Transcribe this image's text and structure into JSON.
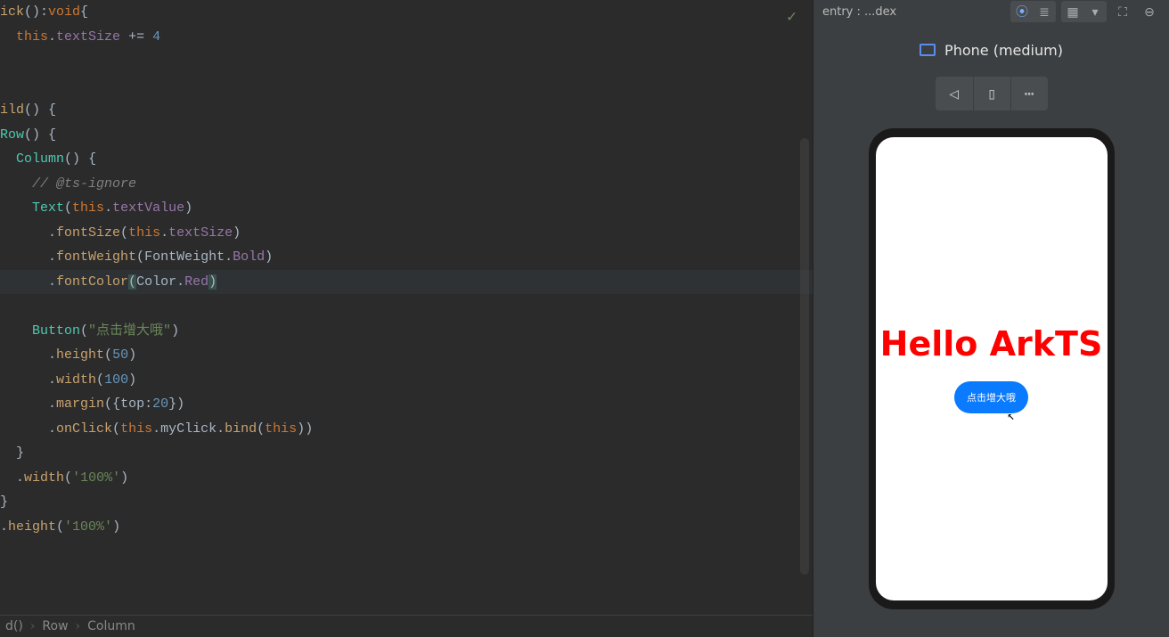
{
  "editor": {
    "checkmark": "✓",
    "lines": {
      "l0": {
        "p0": "ick",
        "paren1": "():",
        "kw": "void",
        "brace": "{"
      },
      "l1": {
        "indent": "  ",
        "kw": "this",
        "dot": ".",
        "prop": "textSize",
        "op": " += ",
        "num": "4"
      },
      "l2": "",
      "l3": "",
      "l4": {
        "fn": "ild",
        "paren": "()",
        "sp": " ",
        "brace": "{"
      },
      "l5": {
        "fn": "Row",
        "paren": "()",
        "sp": " ",
        "brace": "{"
      },
      "l6": {
        "indent": "  ",
        "fn": "Column",
        "paren": "()",
        "sp": " ",
        "brace": "{"
      },
      "l7": {
        "indent": "    ",
        "comment": "// @ts-ignore"
      },
      "l8": {
        "indent": "    ",
        "fn": "Text",
        "p1": "(",
        "kw": "this",
        "dot": ".",
        "prop": "textValue",
        "p2": ")"
      },
      "l9": {
        "indent": "      ",
        "dot": ".",
        "fn": "fontSize",
        "p1": "(",
        "kw": "this",
        "dot2": ".",
        "prop": "textSize",
        "p2": ")"
      },
      "l10": {
        "indent": "      ",
        "dot": ".",
        "fn": "fontWeight",
        "p1": "(",
        "a": "FontWeight",
        "d": ".",
        "b": "Bold",
        "p2": ")"
      },
      "l11": {
        "indent": "      ",
        "dot": ".",
        "fn": "fontColor",
        "p1": "(",
        "a": "Color",
        "d": ".",
        "b": "Red",
        "p2": ")"
      },
      "l12": "",
      "l13": {
        "indent": "    ",
        "fn": "Button",
        "p1": "(",
        "str": "\"点击增大哦\"",
        "p2": ")"
      },
      "l14": {
        "indent": "      ",
        "dot": ".",
        "fn": "height",
        "p1": "(",
        "num": "50",
        "p2": ")"
      },
      "l15": {
        "indent": "      ",
        "dot": ".",
        "fn": "width",
        "p1": "(",
        "num": "100",
        "p2": ")"
      },
      "l16": {
        "indent": "      ",
        "dot": ".",
        "fn": "margin",
        "p1": "(",
        "b1": "{",
        "k": "top",
        "c": ":",
        "num": "20",
        "b2": "}",
        "p2": ")"
      },
      "l17": {
        "indent": "      ",
        "dot": ".",
        "fn": "onClick",
        "p1": "(",
        "kw": "this",
        "d": ".",
        "m": "myClick",
        "d2": ".",
        "bind": "bind",
        "p2": "(",
        "kw2": "this",
        "p3": ")",
        "p4": ")"
      },
      "l18": {
        "indent": "  ",
        "brace": "}"
      },
      "l19": {
        "indent": "  ",
        "dot": ".",
        "fn": "width",
        "p1": "(",
        "str": "'100%'",
        "p2": ")"
      },
      "l20": {
        "brace": "}"
      },
      "l21": {
        "dot": ".",
        "fn": "height",
        "p1": "(",
        "str": "'100%'",
        "p2": ")"
      }
    }
  },
  "breadcrumb": {
    "a": "d()",
    "sep": "›",
    "b": "Row",
    "c": "Column"
  },
  "preview": {
    "entryLabel": "entry : ...dex",
    "deviceLabel": "Phone (medium)",
    "phoneText": "Hello ArkTS",
    "buttonLabel": "点击增大哦"
  }
}
